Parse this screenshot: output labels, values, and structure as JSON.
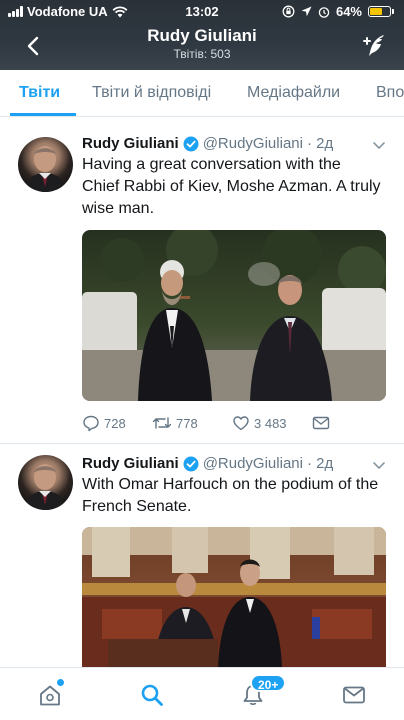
{
  "status_bar": {
    "carrier": "Vodafone UA",
    "time": "13:02",
    "battery": "64%",
    "battery_level": 0.64
  },
  "header": {
    "title": "Rudy Giuliani",
    "tweet_count": "Твітів: 503",
    "back_icon": "chevron-left-icon",
    "compose_icon": "compose-tweet-icon"
  },
  "tabs": [
    {
      "label": "Твіти",
      "active": true
    },
    {
      "label": "Твіти й відповіді",
      "active": false
    },
    {
      "label": "Медіафайли",
      "active": false
    },
    {
      "label": "Впо",
      "active": false
    }
  ],
  "tweets": [
    {
      "name": "Rudy Giuliani",
      "handle": "@RudyGiuliani",
      "time": "· 2д",
      "text": "Having a great conversation with the Chief Rabbi of Kiev, Moshe Azman. A truly wise man.",
      "replies": "728",
      "retweets": "778",
      "likes": "3 483"
    },
    {
      "name": "Rudy Giuliani",
      "handle": "@RudyGiuliani",
      "time": "· 2д",
      "text": "With Omar Harfouch on the podium of the French Senate."
    }
  ],
  "bottom_nav": {
    "notifications_badge": "20+",
    "items": [
      "home-icon",
      "search-icon",
      "notifications-icon",
      "messages-icon"
    ]
  },
  "colors": {
    "accent": "#1da1f2",
    "header_bg": "#2f3841",
    "text_secondary": "#657786"
  }
}
